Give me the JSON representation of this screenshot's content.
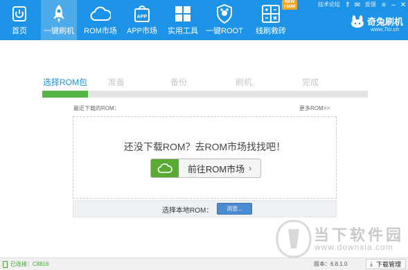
{
  "toolbar": {
    "items": [
      {
        "label": "首页",
        "icon": "home-icon"
      },
      {
        "label": "一键刷机",
        "icon": "rocket-icon",
        "active": true
      },
      {
        "label": "ROM市场",
        "icon": "cloud-icon"
      },
      {
        "label": "APP市场",
        "icon": "app-bag-icon"
      },
      {
        "label": "实用工具",
        "icon": "grid-icon"
      },
      {
        "label": "一键ROOT",
        "icon": "shield-icon"
      },
      {
        "label": "线刷救砖",
        "icon": "tools-grid-icon"
      }
    ],
    "new_badge_line1": "NEW",
    "new_badge_line2": "+1000",
    "forum_link": "技术论坛",
    "feedback_link": "反馈",
    "brand_name": "奇兔刷机",
    "brand_url": "www.7to.cn",
    "colors": {
      "bar": "#1c93e6",
      "active": "#4aaff0"
    }
  },
  "steps": {
    "items": [
      "选择ROM包",
      "准备",
      "备份",
      "刷机",
      "完成"
    ],
    "current_index": 0,
    "progress": 0.14,
    "colors": {
      "active": "#1b8fdc",
      "inactive": "#c8c8c8",
      "fill": "#56b548",
      "track": "#e3e3e3"
    }
  },
  "recent": {
    "label": "最近下载的ROM：",
    "more_link": "更多ROM>>"
  },
  "empty_state": {
    "message": "还没下载ROM？去ROM市场找找吧！",
    "button_label": "前往ROM市场",
    "button_chevron": "›"
  },
  "local": {
    "label": "选择本地ROM：",
    "browse_label": "浏览..."
  },
  "watermark": {
    "text": "当下软件园",
    "url": "www.downxia.com"
  },
  "status": {
    "connection": "已连接：C8816",
    "version": "版本：6.8.1.0",
    "download_manager": "下载管理"
  }
}
